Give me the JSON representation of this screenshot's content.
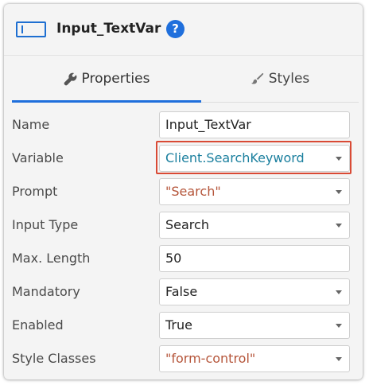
{
  "header": {
    "title": "Input_TextVar",
    "help": "?"
  },
  "tabs": {
    "properties": "Properties",
    "styles": "Styles"
  },
  "properties": [
    {
      "label": "Name",
      "value": "Input_TextVar",
      "type": "text"
    },
    {
      "label": "Variable",
      "value": "Client.SearchKeyword",
      "type": "dropdown"
    },
    {
      "label": "Prompt",
      "value": "\"Search\"",
      "type": "dropdown"
    },
    {
      "label": "Input Type",
      "value": "Search",
      "type": "dropdown"
    },
    {
      "label": "Max. Length",
      "value": "50",
      "type": "text"
    },
    {
      "label": "Mandatory",
      "value": "False",
      "type": "dropdown"
    },
    {
      "label": "Enabled",
      "value": "True",
      "type": "dropdown"
    },
    {
      "label": "Style Classes",
      "value": "\"form-control\"",
      "type": "dropdown"
    }
  ],
  "colors": {
    "accent": "#1f6fdc",
    "variable_text": "#1a7f9e",
    "string_literal": "#b5553a",
    "highlight_border": "#d94a35"
  }
}
